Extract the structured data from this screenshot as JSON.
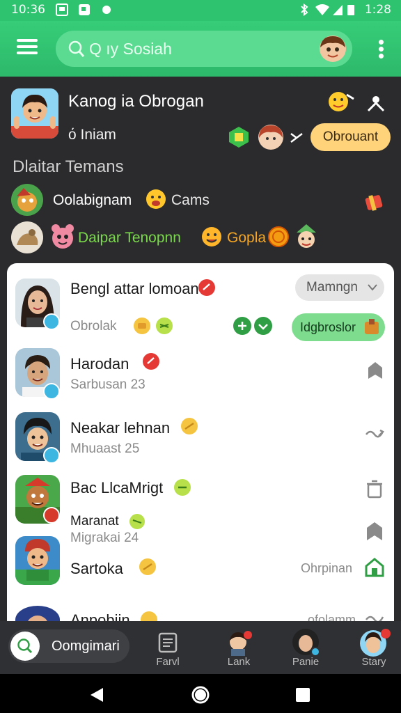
{
  "status_bar": {
    "time_left": "10:36",
    "time_right": "1:28"
  },
  "app_bar": {
    "search_text": "Q ıy Sosiah"
  },
  "profile": {
    "name": "Kanog ia Obrogan",
    "subtitle": "ό Iniam",
    "follow_label": "Obrouant"
  },
  "section_title": "Dlaitar Temans",
  "friends": [
    {
      "text": "Oolabignam",
      "extra": "Cams"
    },
    {
      "text": "Daipar Tenopnn",
      "extra": "Gopla"
    }
  ],
  "contacts": [
    {
      "name": "Bengl attar lomoan",
      "sub": "Obrolak",
      "pill_grey": "Mamngn",
      "pill_green": "Idgbroslor"
    },
    {
      "name": "Harodan",
      "sub": "Sarbusan 23"
    },
    {
      "name": "Neakar lehnan",
      "sub": "Mhuaast 25"
    },
    {
      "name": "Bac LlcaMrigt",
      "sub": "Maranat",
      "sub2": "Migrakai 24"
    },
    {
      "name": "Sartoka",
      "right_text": "Ohrpinan"
    },
    {
      "name": "Anpobiin",
      "right_text": "ofolamm"
    }
  ],
  "bottom_nav": {
    "search_label": "Oomgimari",
    "items": [
      {
        "label": "Farvl"
      },
      {
        "label": "Lank"
      },
      {
        "label": "Panie"
      },
      {
        "label": "Stary"
      }
    ]
  },
  "colors": {
    "app_green": "#2ec36f",
    "dark_bg": "#2b2b2e",
    "follow_yellow": "#ffd37a",
    "pill_green": "#7edc8e",
    "badge_red": "#e53935",
    "friend_green": "#7ad94b"
  }
}
